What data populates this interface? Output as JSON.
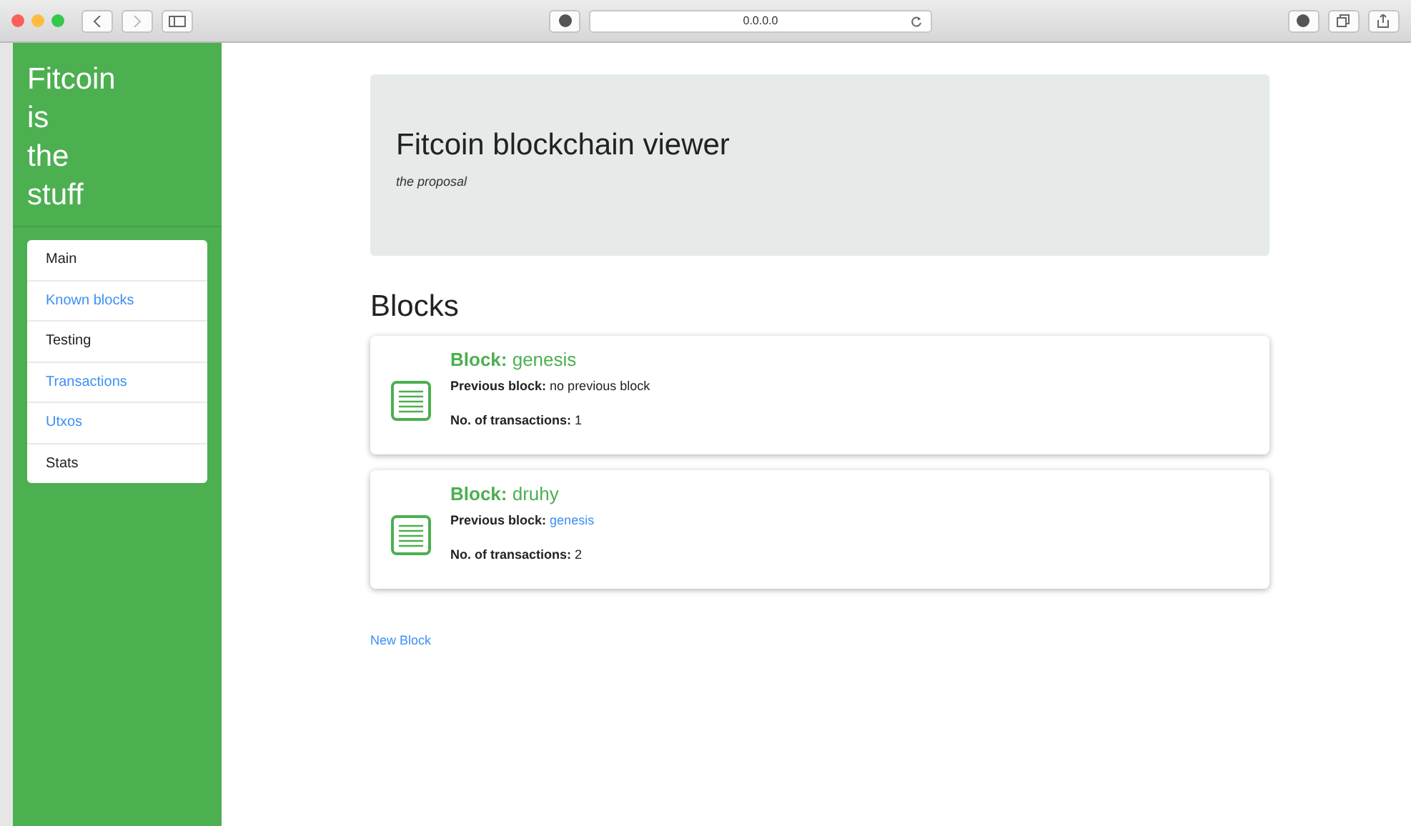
{
  "browser": {
    "url": "0.0.0.0"
  },
  "sidebar": {
    "title_lines": [
      "Fitcoin",
      "is",
      "the",
      "stuff"
    ],
    "items": [
      {
        "label": "Main",
        "kind": "text"
      },
      {
        "label": "Known blocks",
        "kind": "link"
      },
      {
        "label": "Testing",
        "kind": "text"
      },
      {
        "label": "Transactions",
        "kind": "link"
      },
      {
        "label": "Utxos",
        "kind": "link"
      },
      {
        "label": "Stats",
        "kind": "text"
      }
    ]
  },
  "header": {
    "title": "Fitcoin blockchain viewer",
    "subtitle": "the proposal"
  },
  "section_title": "Blocks",
  "blocks": [
    {
      "title": "**Block:** genesis",
      "previous_label": "Previous block:",
      "previous": {
        "kind": "text",
        "text": "no previous block"
      },
      "tx_label": "No. of transactions:",
      "tx": "1"
    },
    {
      "title": "**Block:** druhy",
      "previous_label": "Previous block:",
      "previous": {
        "kind": "link",
        "text": "genesis"
      },
      "tx_label": "No. of transactions:",
      "tx": "2"
    }
  ],
  "new_block_link": "New Block"
}
